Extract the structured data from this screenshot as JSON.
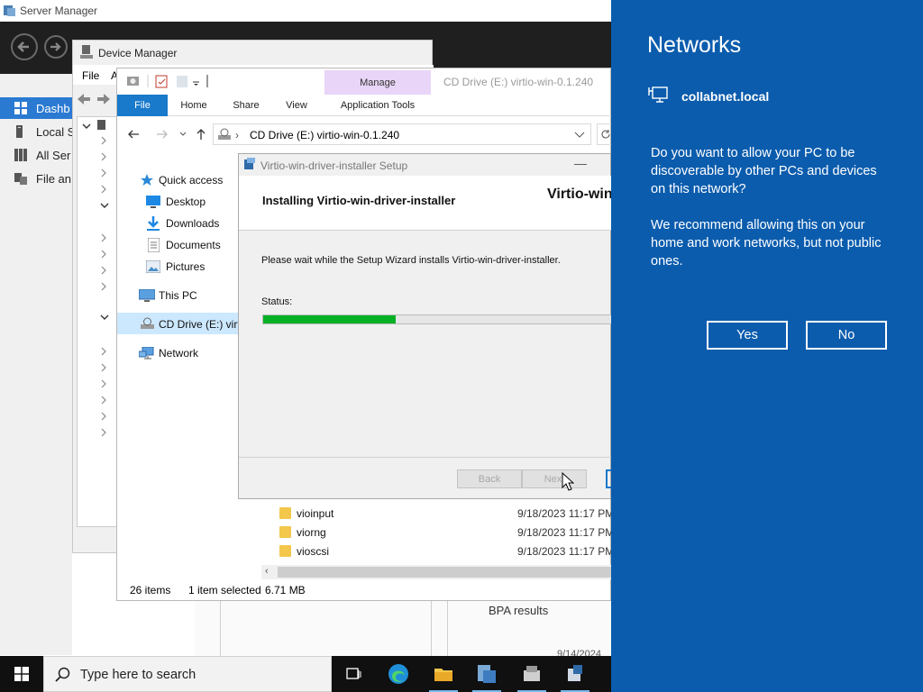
{
  "server_manager": {
    "title": "Server Manager",
    "sidebar": [
      {
        "label": "Dashb",
        "icon": "dashboard-icon"
      },
      {
        "label": "Local S",
        "icon": "local-server-icon"
      },
      {
        "label": "All Ser",
        "icon": "all-servers-icon"
      },
      {
        "label": "File an",
        "icon": "file-services-icon"
      }
    ],
    "bpa_results": "BPA results",
    "date_fragment": "9/14/2024"
  },
  "device_manager": {
    "title": "Device Manager",
    "menu": [
      "File",
      "A"
    ]
  },
  "explorer": {
    "ribbon_group": "Manage",
    "tabs": [
      "File",
      "Home",
      "Share",
      "View",
      "Application Tools"
    ],
    "window_title": "CD Drive (E:) virtio-win-0.1.240",
    "address": "CD Drive (E:) virtio-win-0.1.240",
    "nav": {
      "quick_access": "Quick access",
      "desktop": "Desktop",
      "downloads": "Downloads",
      "documents": "Documents",
      "pictures": "Pictures",
      "this_pc": "This PC",
      "cd_drive": "CD Drive (E:) virti",
      "network": "Network"
    },
    "files": [
      {
        "name": "vioinput",
        "date": "9/18/2023 11:17 PM"
      },
      {
        "name": "viorng",
        "date": "9/18/2023 11:17 PM"
      },
      {
        "name": "vioscsi",
        "date": "9/18/2023 11:17 PM"
      }
    ],
    "status": {
      "items": "26 items",
      "selected": "1 item selected",
      "size": "6.71 MB"
    }
  },
  "setup": {
    "title": "Virtio-win-driver-installer Setup",
    "heading": "Installing Virtio-win-driver-installer",
    "brand": "Virtio-win",
    "message": "Please wait while the Setup Wizard installs Virtio-win-driver-installer.",
    "status_label": "Status:",
    "progress_fraction": 0.38,
    "back": "Back",
    "next": "Next"
  },
  "taskbar": {
    "search_placeholder": "Type here to search"
  },
  "networks": {
    "heading": "Networks",
    "network_name": "collabnet.local",
    "question": "Do you want to allow your PC to be discoverable by other PCs and devices on this network?",
    "recommendation": "We recommend allowing this on your home and work networks, but not public ones.",
    "yes": "Yes",
    "no": "No"
  },
  "colors": {
    "flyout_bg": "#0b5cad",
    "progress_green": "#06b025",
    "ribbon_manage": "#e8d5f7",
    "file_tab": "#1979ca"
  }
}
